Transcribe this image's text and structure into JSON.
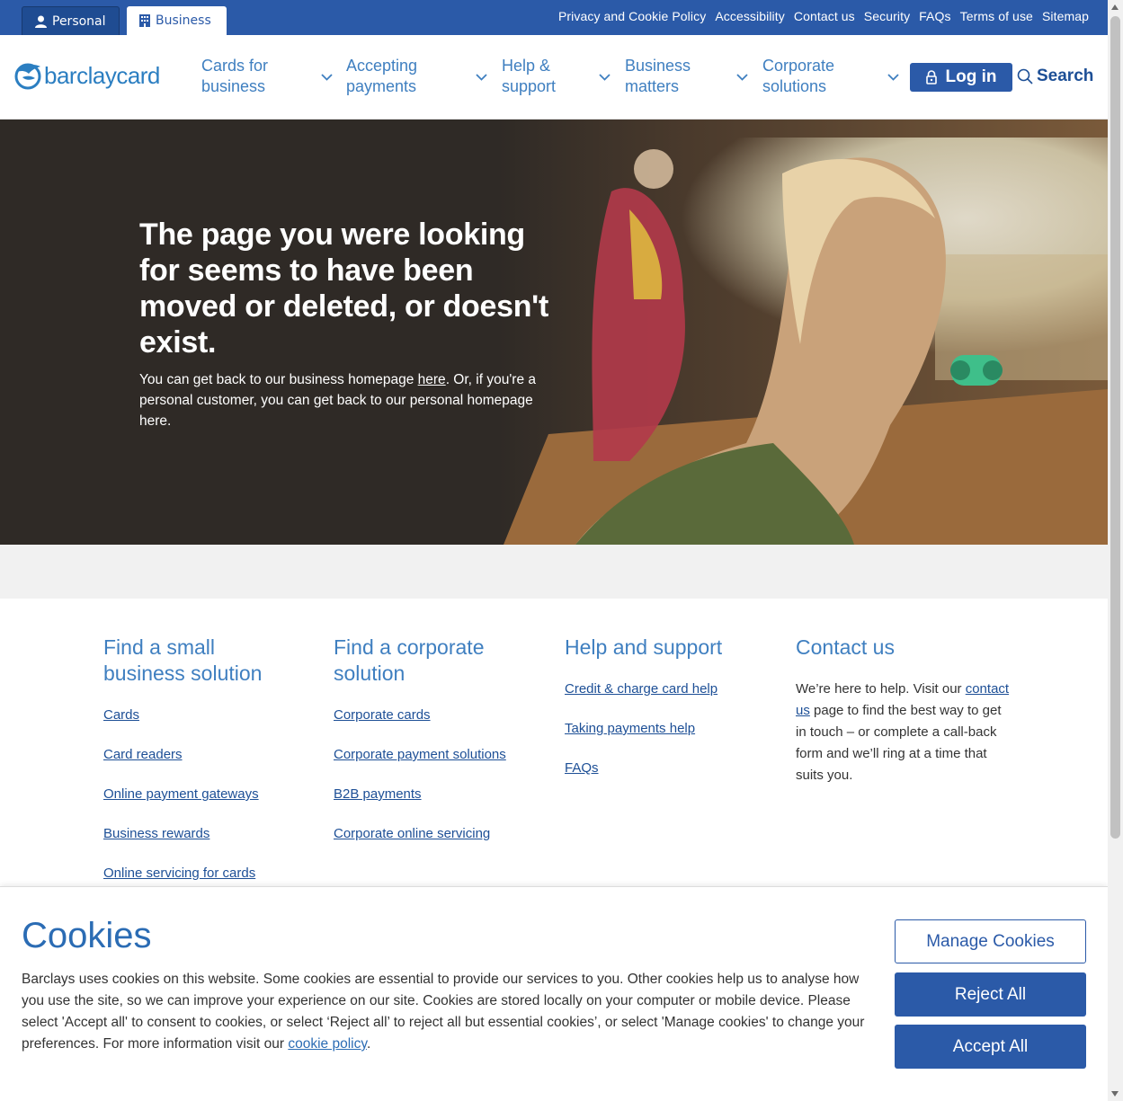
{
  "utility": {
    "tabs": [
      {
        "label": "Personal",
        "icon": "person-icon"
      },
      {
        "label": "Business",
        "icon": "building-icon"
      }
    ],
    "links": [
      "Privacy and Cookie Policy",
      "Accessibility",
      "Contact us",
      "Security",
      "FAQs",
      "Terms of use",
      "Sitemap"
    ]
  },
  "nav": {
    "logo": "barclaycard",
    "items": [
      {
        "label": "Cards for\nbusiness"
      },
      {
        "label": "Accepting\npayments"
      },
      {
        "label": "Help &\nsupport"
      },
      {
        "label": "Business\nmatters"
      },
      {
        "label": "Corporate\nsolutions"
      }
    ],
    "login_label": "Log in",
    "search_label": "Search"
  },
  "hero": {
    "title": "The page you were looking for seems to have been moved or deleted, or doesn't exist.",
    "text_1": "You can get back to our business homepage ",
    "text_link_1": "here",
    "text_2": ". Or, if you're a personal customer, you can get back to our personal homepage ",
    "text_link_2": "here",
    "text_3": "."
  },
  "footer": {
    "small_business": {
      "title": "Find a small\nbusiness solution",
      "links": [
        "Cards",
        "Card readers",
        "Online payment gateways",
        "Business rewards",
        "Online servicing for cards"
      ]
    },
    "corporate": {
      "title": "Find a corporate\nsolution",
      "links": [
        "Corporate cards",
        "Corporate payment solutions",
        "B2B payments",
        "Corporate online servicing"
      ]
    },
    "help": {
      "title": "Help and support",
      "links": [
        "Credit & charge card help",
        "Taking payments help",
        "FAQs"
      ]
    },
    "contact": {
      "title": "Contact us",
      "text_1": "We’re here to help. Visit our ",
      "link": "contact us",
      "text_2": "  page to find the best way to get in touch – or complete a call-back form and we’ll ring at a time that suits you."
    }
  },
  "cookie": {
    "title": "Cookies",
    "text": "Barclays uses cookies on this website. Some cookies are essential to provide our services to you. Other cookies help us to analyse how you use the site, so we can improve your experience on our site. Cookies are stored locally on your computer or mobile device. Please select 'Accept all' to consent to cookies, or select ‘Reject all’ to reject all but essential cookies’, or select 'Manage cookies' to change your preferences. For more information visit our ",
    "link": "cookie policy",
    "text_end": ".",
    "manage_label": "Manage Cookies",
    "reject_label": "Reject All",
    "accept_label": "Accept All"
  },
  "colors": {
    "brand_blue": "#2b5aa8",
    "link_blue": "#3f7fc0",
    "logo_blue": "#2b7ec1"
  }
}
